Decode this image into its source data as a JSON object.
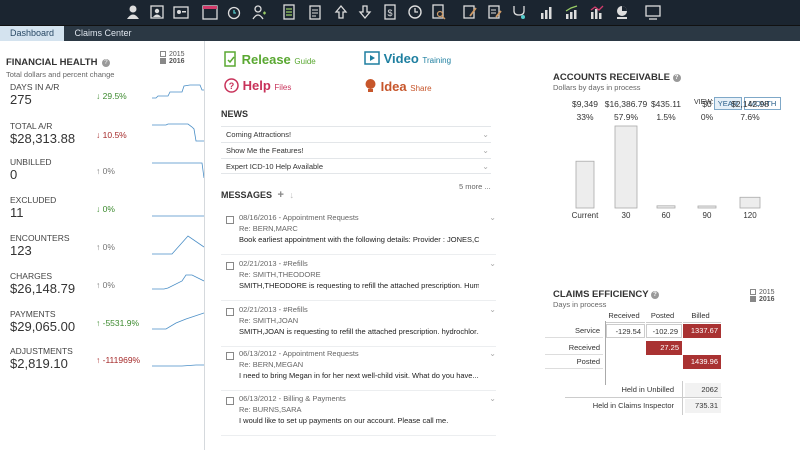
{
  "colors": {
    "topbar": "#1b2530",
    "accent_green": "#3c8a2e",
    "accent_red": "#a52a2a",
    "link_green": "#5aa832",
    "link_blue": "#1e7fa0",
    "link_pink": "#c8325a",
    "link_orange": "#c7562b"
  },
  "toolbar_icons": [
    "user-icon",
    "users-icon",
    "id-card-icon",
    "calendar-icon",
    "alarm-icon",
    "person-plus-icon",
    "list-icon",
    "clipboard-icon",
    "upload-icon",
    "download-icon",
    "dollar-icon",
    "clock-icon",
    "search-doc-icon",
    "edit-icon",
    "edit-list-icon",
    "stethoscope-icon",
    "bar-chart-icon",
    "growth-chart-icon",
    "stats-icon",
    "pie-chart-icon",
    "monitor-icon"
  ],
  "tabs": [
    {
      "label": "Dashboard",
      "active": true
    },
    {
      "label": "Claims Center",
      "active": false
    }
  ],
  "financial_health": {
    "title": "FINANCIAL HEALTH",
    "subtitle": "Total dollars and percent change",
    "legend": [
      "2015",
      "2016"
    ],
    "metrics": [
      {
        "label": "DAYS IN A/R",
        "value": "275",
        "change": "29.5%",
        "dir": "down",
        "tone": "green"
      },
      {
        "label": "TOTAL A/R",
        "value": "$28,313.88",
        "change": "10.5%",
        "dir": "down",
        "tone": "red"
      },
      {
        "label": "UNBILLED",
        "value": "0",
        "change": "0%",
        "dir": "up",
        "tone": "gray"
      },
      {
        "label": "EXCLUDED",
        "value": "11",
        "change": "0%",
        "dir": "down",
        "tone": "green"
      },
      {
        "label": "ENCOUNTERS",
        "value": "123",
        "change": "0%",
        "dir": "up",
        "tone": "gray"
      },
      {
        "label": "CHARGES",
        "value": "$26,148.79",
        "change": "0%",
        "dir": "up",
        "tone": "gray"
      },
      {
        "label": "PAYMENTS",
        "value": "$29,065.00",
        "change": "-5531.9%",
        "dir": "up",
        "tone": "green"
      },
      {
        "label": "ADJUSTMENTS",
        "value": "$2,819.10",
        "change": "-111969%",
        "dir": "up",
        "tone": "red"
      }
    ]
  },
  "links": [
    {
      "main": "Release",
      "small": "Guide",
      "icon": "release-icon"
    },
    {
      "main": "Video",
      "small": "Training",
      "icon": "video-icon"
    },
    {
      "main": "Help",
      "small": "Files",
      "icon": "help-icon"
    },
    {
      "main": "Idea",
      "small": "Share",
      "icon": "idea-icon"
    }
  ],
  "news": {
    "title": "NEWS",
    "items": [
      "Coming Attractions!",
      "Show Me the Features!",
      "Expert ICD-10 Help Available"
    ],
    "more": "5 more ..."
  },
  "messages": {
    "title": "MESSAGES",
    "items": [
      {
        "date_subject": "08/16/2016 - Appointment Requests",
        "re": "Re: BERN,MARC",
        "body": "Book earliest appointment with the following details: Provider : JONES,C..."
      },
      {
        "date_subject": "02/21/2013 - #Refills",
        "re": "Re: SMITH,THEODORE",
        "body": "SMITH,THEODORE is requesting to refill the attached prescription. Hum..."
      },
      {
        "date_subject": "02/21/2013 - #Refills",
        "re": "Re: SMITH,JOAN",
        "body": "SMITH,JOAN is requesting to refill the attached prescription. hydrochlor..."
      },
      {
        "date_subject": "06/13/2012 - Appointment Requests",
        "re": "Re: BERN,MEGAN",
        "body": "I need to bring Megan in for her next well-child visit. What do you have..."
      },
      {
        "date_subject": "06/13/2012 - Billing & Payments",
        "re": "Re: BURNS,SARA",
        "body": "I would like to set up payments on our account. Please call me."
      }
    ]
  },
  "ar": {
    "view_label": "VIEW:",
    "year_btn": "YEAR",
    "month_btn": "MONTH",
    "title": "ACCOUNTS RECEIVABLE",
    "subtitle": "Dollars by days in process"
  },
  "chart_data": {
    "type": "bar",
    "title": "ACCOUNTS RECEIVABLE",
    "subtitle": "Dollars by days in process",
    "categories": [
      "Current",
      "30",
      "60",
      "90",
      "120"
    ],
    "values": [
      9349,
      16386.79,
      435.11,
      0,
      2142.98
    ],
    "value_labels": [
      "$9,349",
      "$16,386.79",
      "$435.11",
      "$0",
      "$2,142.98"
    ],
    "percent_labels": [
      "33%",
      "57.9%",
      "1.5%",
      "0%",
      "7.6%"
    ],
    "ylim": [
      0,
      16386.79
    ]
  },
  "claims_efficiency": {
    "title": "CLAIMS EFFICIENCY",
    "subtitle": "Days in process",
    "legend": [
      "2015",
      "2016"
    ],
    "col_headers": [
      "Received",
      "Posted",
      "Billed"
    ],
    "row_headers": [
      "Service",
      "Received",
      "Posted"
    ],
    "cells": [
      [
        "-129.54",
        "-102.29",
        "1337.67"
      ],
      [
        "",
        "27.25",
        ""
      ],
      [
        "",
        "",
        "1439.96"
      ]
    ],
    "held_unbilled_label": "Held in Unbilled",
    "held_unbilled_value": "2062",
    "held_inspector_label": "Held in Claims Inspector",
    "held_inspector_value": "735.31"
  }
}
